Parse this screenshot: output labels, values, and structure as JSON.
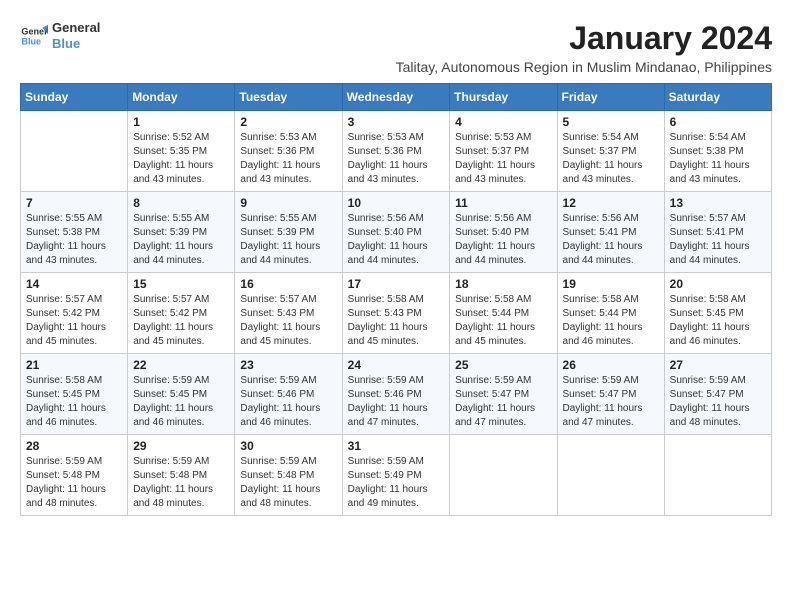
{
  "header": {
    "logo_line1": "General",
    "logo_line2": "Blue",
    "main_title": "January 2024",
    "subtitle": "Talitay, Autonomous Region in Muslim Mindanao, Philippines"
  },
  "calendar": {
    "days_of_week": [
      "Sunday",
      "Monday",
      "Tuesday",
      "Wednesday",
      "Thursday",
      "Friday",
      "Saturday"
    ],
    "weeks": [
      [
        {
          "day": "",
          "info": ""
        },
        {
          "day": "1",
          "info": "Sunrise: 5:52 AM\nSunset: 5:35 PM\nDaylight: 11 hours\nand 43 minutes."
        },
        {
          "day": "2",
          "info": "Sunrise: 5:53 AM\nSunset: 5:36 PM\nDaylight: 11 hours\nand 43 minutes."
        },
        {
          "day": "3",
          "info": "Sunrise: 5:53 AM\nSunset: 5:36 PM\nDaylight: 11 hours\nand 43 minutes."
        },
        {
          "day": "4",
          "info": "Sunrise: 5:53 AM\nSunset: 5:37 PM\nDaylight: 11 hours\nand 43 minutes."
        },
        {
          "day": "5",
          "info": "Sunrise: 5:54 AM\nSunset: 5:37 PM\nDaylight: 11 hours\nand 43 minutes."
        },
        {
          "day": "6",
          "info": "Sunrise: 5:54 AM\nSunset: 5:38 PM\nDaylight: 11 hours\nand 43 minutes."
        }
      ],
      [
        {
          "day": "7",
          "info": "Sunrise: 5:55 AM\nSunset: 5:38 PM\nDaylight: 11 hours\nand 43 minutes."
        },
        {
          "day": "8",
          "info": "Sunrise: 5:55 AM\nSunset: 5:39 PM\nDaylight: 11 hours\nand 44 minutes."
        },
        {
          "day": "9",
          "info": "Sunrise: 5:55 AM\nSunset: 5:39 PM\nDaylight: 11 hours\nand 44 minutes."
        },
        {
          "day": "10",
          "info": "Sunrise: 5:56 AM\nSunset: 5:40 PM\nDaylight: 11 hours\nand 44 minutes."
        },
        {
          "day": "11",
          "info": "Sunrise: 5:56 AM\nSunset: 5:40 PM\nDaylight: 11 hours\nand 44 minutes."
        },
        {
          "day": "12",
          "info": "Sunrise: 5:56 AM\nSunset: 5:41 PM\nDaylight: 11 hours\nand 44 minutes."
        },
        {
          "day": "13",
          "info": "Sunrise: 5:57 AM\nSunset: 5:41 PM\nDaylight: 11 hours\nand 44 minutes."
        }
      ],
      [
        {
          "day": "14",
          "info": "Sunrise: 5:57 AM\nSunset: 5:42 PM\nDaylight: 11 hours\nand 45 minutes."
        },
        {
          "day": "15",
          "info": "Sunrise: 5:57 AM\nSunset: 5:42 PM\nDaylight: 11 hours\nand 45 minutes."
        },
        {
          "day": "16",
          "info": "Sunrise: 5:57 AM\nSunset: 5:43 PM\nDaylight: 11 hours\nand 45 minutes."
        },
        {
          "day": "17",
          "info": "Sunrise: 5:58 AM\nSunset: 5:43 PM\nDaylight: 11 hours\nand 45 minutes."
        },
        {
          "day": "18",
          "info": "Sunrise: 5:58 AM\nSunset: 5:44 PM\nDaylight: 11 hours\nand 45 minutes."
        },
        {
          "day": "19",
          "info": "Sunrise: 5:58 AM\nSunset: 5:44 PM\nDaylight: 11 hours\nand 46 minutes."
        },
        {
          "day": "20",
          "info": "Sunrise: 5:58 AM\nSunset: 5:45 PM\nDaylight: 11 hours\nand 46 minutes."
        }
      ],
      [
        {
          "day": "21",
          "info": "Sunrise: 5:58 AM\nSunset: 5:45 PM\nDaylight: 11 hours\nand 46 minutes."
        },
        {
          "day": "22",
          "info": "Sunrise: 5:59 AM\nSunset: 5:45 PM\nDaylight: 11 hours\nand 46 minutes."
        },
        {
          "day": "23",
          "info": "Sunrise: 5:59 AM\nSunset: 5:46 PM\nDaylight: 11 hours\nand 46 minutes."
        },
        {
          "day": "24",
          "info": "Sunrise: 5:59 AM\nSunset: 5:46 PM\nDaylight: 11 hours\nand 47 minutes."
        },
        {
          "day": "25",
          "info": "Sunrise: 5:59 AM\nSunset: 5:47 PM\nDaylight: 11 hours\nand 47 minutes."
        },
        {
          "day": "26",
          "info": "Sunrise: 5:59 AM\nSunset: 5:47 PM\nDaylight: 11 hours\nand 47 minutes."
        },
        {
          "day": "27",
          "info": "Sunrise: 5:59 AM\nSunset: 5:47 PM\nDaylight: 11 hours\nand 48 minutes."
        }
      ],
      [
        {
          "day": "28",
          "info": "Sunrise: 5:59 AM\nSunset: 5:48 PM\nDaylight: 11 hours\nand 48 minutes."
        },
        {
          "day": "29",
          "info": "Sunrise: 5:59 AM\nSunset: 5:48 PM\nDaylight: 11 hours\nand 48 minutes."
        },
        {
          "day": "30",
          "info": "Sunrise: 5:59 AM\nSunset: 5:48 PM\nDaylight: 11 hours\nand 48 minutes."
        },
        {
          "day": "31",
          "info": "Sunrise: 5:59 AM\nSunset: 5:49 PM\nDaylight: 11 hours\nand 49 minutes."
        },
        {
          "day": "",
          "info": ""
        },
        {
          "day": "",
          "info": ""
        },
        {
          "day": "",
          "info": ""
        }
      ]
    ]
  }
}
